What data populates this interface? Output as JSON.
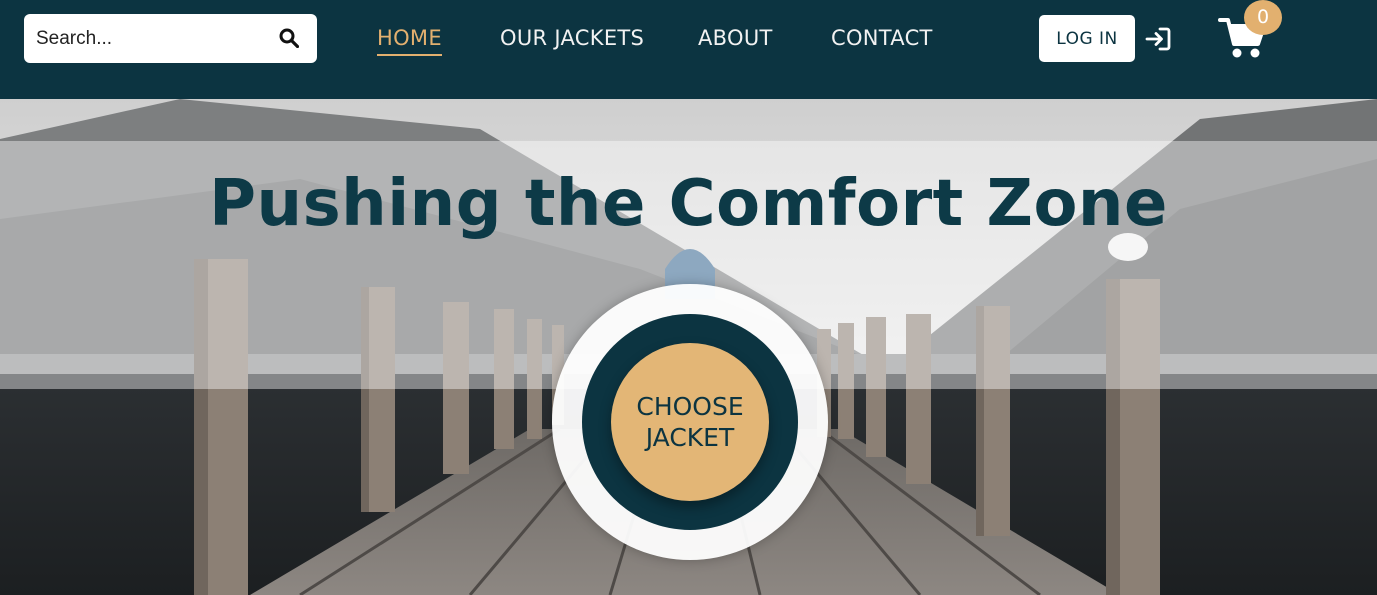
{
  "search": {
    "placeholder": "Search...",
    "value": ""
  },
  "nav": {
    "items": [
      {
        "label": "HOME",
        "active": true
      },
      {
        "label": "OUR JACKETS",
        "active": false
      },
      {
        "label": "ABOUT",
        "active": false
      },
      {
        "label": "CONTACT",
        "active": false
      }
    ]
  },
  "account": {
    "login_label": "LOG IN"
  },
  "cart": {
    "count": "0"
  },
  "hero": {
    "headline": "Pushing the Comfort Zone",
    "cta_label": "CHOOSE JACKET"
  },
  "colors": {
    "primary": "#0c3441",
    "accent": "#e3b06f",
    "white": "#ffffff"
  },
  "icons": {
    "search": "search-icon",
    "login": "login-icon",
    "cart": "cart-icon"
  }
}
